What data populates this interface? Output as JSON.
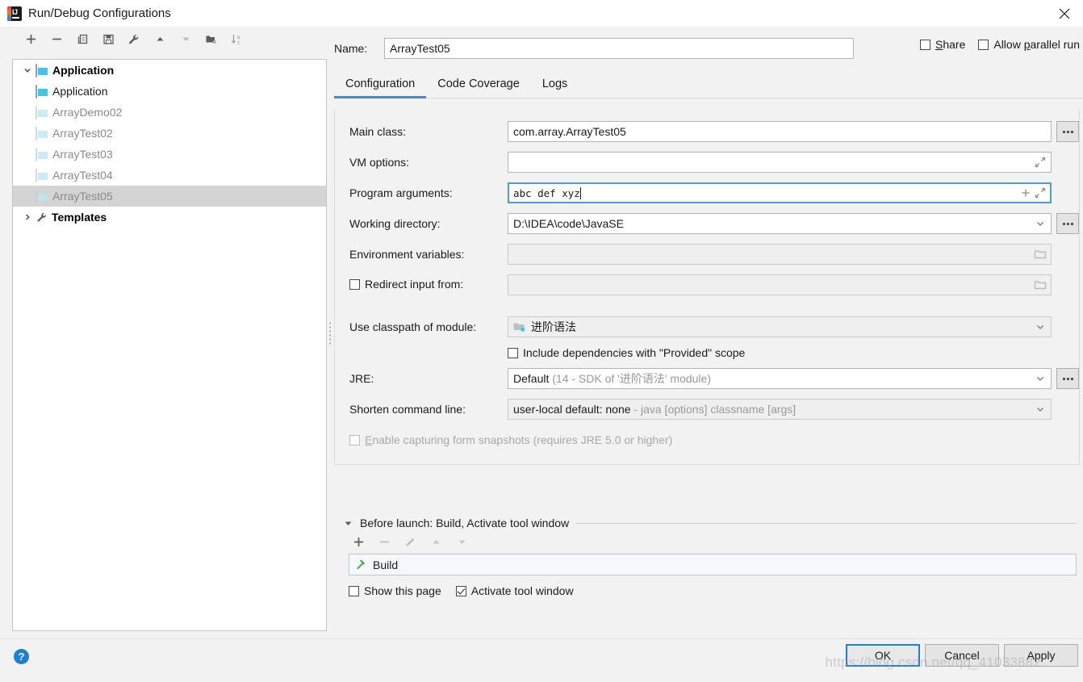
{
  "window": {
    "title": "Run/Debug Configurations",
    "logo_icon": "intellij-idea-logo",
    "close_icon": "close-icon"
  },
  "tree_toolbar": [
    {
      "name": "add-button",
      "icon": "plus-icon",
      "enabled": true
    },
    {
      "name": "remove-button",
      "icon": "minus-icon",
      "enabled": true
    },
    {
      "name": "copy-button",
      "icon": "copy-icon",
      "enabled": true
    },
    {
      "name": "save-button",
      "icon": "save-floppy-icon",
      "enabled": true
    },
    {
      "name": "edit-templates-button",
      "icon": "wrench-icon",
      "enabled": true
    },
    {
      "name": "move-up-button",
      "icon": "arrow-up-icon",
      "enabled": true
    },
    {
      "name": "move-down-button",
      "icon": "arrow-down-icon",
      "enabled": false
    },
    {
      "name": "new-folder-button",
      "icon": "folder-add-icon",
      "enabled": true
    },
    {
      "name": "sort-button",
      "icon": "sort-az-icon",
      "enabled": false
    }
  ],
  "tree": {
    "nodes": [
      {
        "label": "Application",
        "level": 0,
        "icon": "application-icon",
        "expanded": true,
        "bold": true,
        "dim": false,
        "selected": false
      },
      {
        "label": "Application",
        "level": 1,
        "icon": "application-icon",
        "bold": false,
        "dim": false,
        "selected": false
      },
      {
        "label": "ArrayDemo02",
        "level": 1,
        "icon": "application-icon",
        "bold": false,
        "dim": true,
        "selected": false
      },
      {
        "label": "ArrayTest02",
        "level": 1,
        "icon": "application-icon",
        "bold": false,
        "dim": true,
        "selected": false
      },
      {
        "label": "ArrayTest03",
        "level": 1,
        "icon": "application-icon",
        "bold": false,
        "dim": true,
        "selected": false
      },
      {
        "label": "ArrayTest04",
        "level": 1,
        "icon": "application-icon",
        "bold": false,
        "dim": true,
        "selected": false
      },
      {
        "label": "ArrayTest05",
        "level": 1,
        "icon": "application-icon",
        "bold": false,
        "dim": true,
        "selected": true
      },
      {
        "label": "Templates",
        "level": 0,
        "icon": "wrench-icon",
        "expanded": false,
        "bold": true,
        "dim": false,
        "selected": false
      }
    ]
  },
  "name_row": {
    "label": "Name:",
    "value": "ArrayTest05",
    "placeholder": ""
  },
  "top_checks": {
    "share": {
      "label": "Share",
      "checked": false,
      "mnemonic": "S"
    },
    "parallel": {
      "label": "Allow parallel run",
      "checked": false,
      "mnemonic": "p"
    }
  },
  "tabs": [
    {
      "label": "Configuration",
      "active": true
    },
    {
      "label": "Code Coverage",
      "active": false
    },
    {
      "label": "Logs",
      "active": false
    }
  ],
  "form": {
    "main_class": {
      "label": "Main class:",
      "value": "com.array.ArrayTest05",
      "browse": "...",
      "disabled": false
    },
    "vm_options": {
      "label": "VM options:",
      "value": "",
      "expand_icon": "expand-diagonal-icon",
      "disabled": false
    },
    "program_arguments": {
      "label": "Program arguments:",
      "value": "abc def xyz",
      "focused": true,
      "plus_icon": "plus-icon",
      "expand_icon": "expand-diagonal-icon"
    },
    "working_directory": {
      "label": "Working directory:",
      "value": "D:\\IDEA\\code\\JavaSE",
      "dropdown_icon": "chevron-down-icon",
      "browse": "..."
    },
    "environment_variables": {
      "label": "Environment variables:",
      "value": "",
      "folder_icon": "folder-icon",
      "disabled": true
    },
    "redirect_input": {
      "label": "Redirect input from:",
      "checked": false,
      "value": "",
      "folder_icon": "folder-icon",
      "disabled": true
    },
    "classpath_module": {
      "label": "Use classpath of module:",
      "value": "进阶语法",
      "module_icon": "module-folder-icon",
      "dropdown_icon": "chevron-down-icon",
      "disabled": true
    },
    "include_provided": {
      "label": "Include dependencies with \"Provided\" scope",
      "checked": false
    },
    "jre": {
      "label": "JRE:",
      "value": "Default",
      "hint": "(14 - SDK of '进阶语法' module)",
      "dropdown_icon": "chevron-down-icon",
      "browse": "..."
    },
    "shorten_command_line": {
      "label": "Shorten command line:",
      "value": "user-local default: none",
      "hint": "- java [options] classname [args]",
      "dropdown_icon": "chevron-down-icon",
      "disabled": true
    },
    "form_snapshots": {
      "label": "Enable capturing form snapshots (requires JRE 5.0 or higher)",
      "checked": false,
      "disabled": true,
      "mnemonic": "E"
    }
  },
  "before_launch": {
    "title": "Before launch: Build, Activate tool window",
    "collapse_icon": "caret-down-icon",
    "toolbar": [
      {
        "name": "bl-add-button",
        "icon": "plus-icon",
        "enabled": true
      },
      {
        "name": "bl-remove-button",
        "icon": "minus-icon",
        "enabled": false
      },
      {
        "name": "bl-edit-button",
        "icon": "pencil-icon",
        "enabled": false
      },
      {
        "name": "bl-move-up-button",
        "icon": "arrow-up-icon",
        "enabled": false
      },
      {
        "name": "bl-move-down-button",
        "icon": "arrow-down-icon",
        "enabled": false
      }
    ],
    "items": [
      {
        "label": "Build",
        "icon": "hammer-icon"
      }
    ],
    "show_this_page": {
      "label": "Show this page",
      "checked": false
    },
    "activate_tool_window": {
      "label": "Activate tool window",
      "checked": true
    }
  },
  "footer": {
    "help_icon": "help-question-icon",
    "ok": "OK",
    "cancel": "Cancel",
    "apply": "Apply",
    "watermark": "https://blog.csdn.net/qq_41033882"
  },
  "colors": {
    "accent": "#4a88c7",
    "focus": "#4a9ede",
    "default_button_border": "#1a80d8",
    "selection": "#d4d4d4",
    "window_bg": "#f2f2f2"
  }
}
